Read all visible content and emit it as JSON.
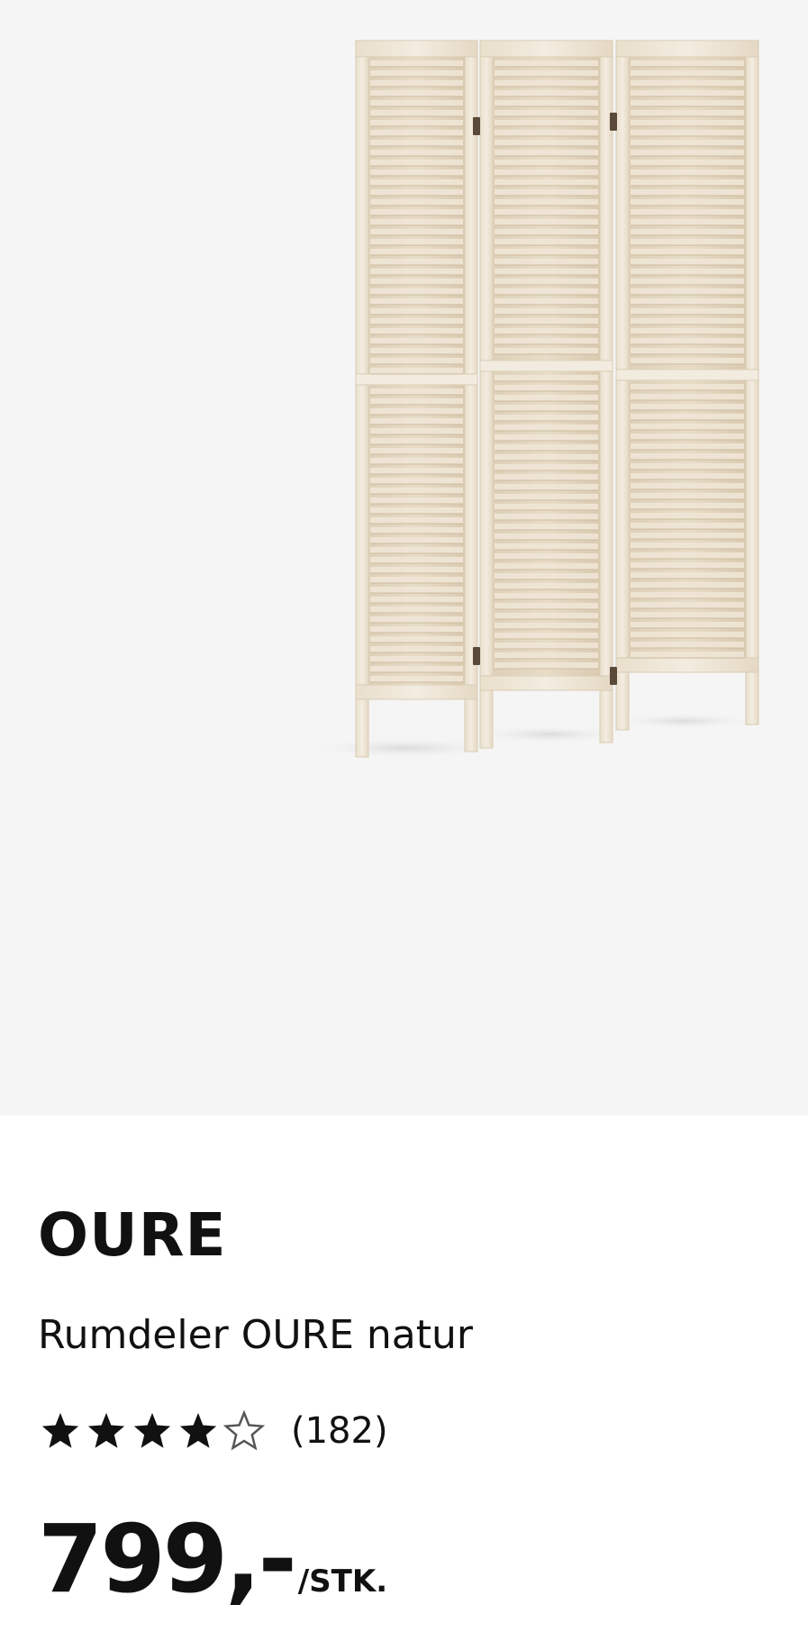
{
  "product": {
    "image_icon": "folding-louvre-room-divider",
    "name": "OURE",
    "description": "Rumdeler OURE natur",
    "rating": {
      "value": 4,
      "max": 5,
      "count_text": "(182)"
    },
    "price": {
      "value": "799,-",
      "unit": "/STK."
    }
  },
  "colors": {
    "image_background": "#f5f5f5",
    "wood": "#efe6d6",
    "text": "#111111"
  }
}
